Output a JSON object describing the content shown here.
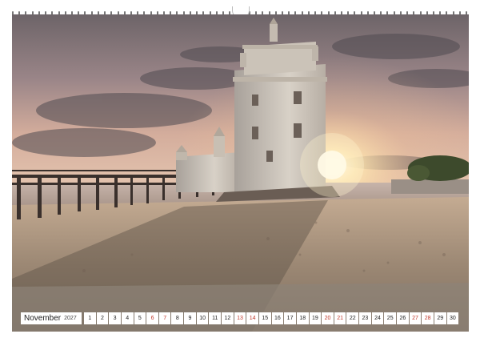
{
  "calendar": {
    "month": "November",
    "year": "2027",
    "days": [
      "1",
      "2",
      "3",
      "4",
      "5",
      "6",
      "7",
      "8",
      "9",
      "10",
      "11",
      "12",
      "13",
      "14",
      "15",
      "16",
      "17",
      "18",
      "19",
      "20",
      "21",
      "22",
      "23",
      "24",
      "25",
      "26",
      "27",
      "28",
      "29",
      "30"
    ],
    "red_days": [
      "6",
      "7",
      "13",
      "14",
      "20",
      "21",
      "27",
      "28"
    ]
  },
  "colors": {
    "sky_top": "#8a7a80",
    "sky_mid": "#c8a49a",
    "sun": "#fff6d8",
    "sand": "#a89480",
    "tower": "#cfc7bc",
    "holiday_text": "#c0392b"
  }
}
